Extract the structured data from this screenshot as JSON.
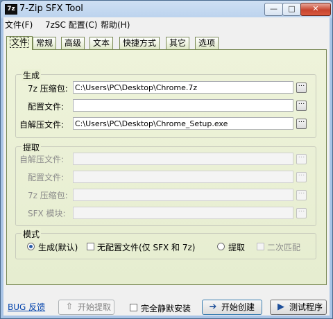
{
  "window": {
    "title": "7-Zip SFX Tool",
    "icon_text": "7z",
    "min_glyph": "—",
    "max_glyph": "□",
    "close_glyph": "✕"
  },
  "menu": [
    "文件(F)",
    "7zSC 配置(C)",
    "帮助(H)"
  ],
  "tabs": [
    "文件",
    "常规",
    "高级",
    "文本",
    "快捷方式",
    "其它",
    "选项"
  ],
  "active_tab": "文件",
  "generate": {
    "title": "生成",
    "archive_label": "7z 压缩包:",
    "archive_value": "C:\\Users\\PC\\Desktop\\Chrome.7z",
    "config_label": "配置文件:",
    "config_value": "",
    "sfx_label": "自解压文件:",
    "sfx_value": "C:\\Users\\PC\\Desktop\\Chrome_Setup.exe",
    "browse_glyph": "···"
  },
  "extract": {
    "title": "提取",
    "sfx_label": "自解压文件:",
    "config_label": "配置文件:",
    "archive_label": "7z 压缩包:",
    "module_label": "SFX 模块:"
  },
  "mode": {
    "title": "模式",
    "generate_default": "生成(默认)",
    "no_config": "无配置文件(仅 SFX 和 7z)",
    "extract": "提取",
    "secondary_match": "二次匹配",
    "selected": "生成(默认)"
  },
  "footer": {
    "bug_link": "BUG 反馈",
    "start_extract": "开始提取",
    "start_extract_icon": "⇧",
    "silent_install": "完全静默安装",
    "start_create": "开始创建",
    "start_create_icon": "➔",
    "test_program": "测试程序",
    "test_program_icon": "▶"
  },
  "colors": {
    "accent": "#2a5ca8",
    "close": "#c7452f",
    "tab_panel": "#eef3da"
  }
}
